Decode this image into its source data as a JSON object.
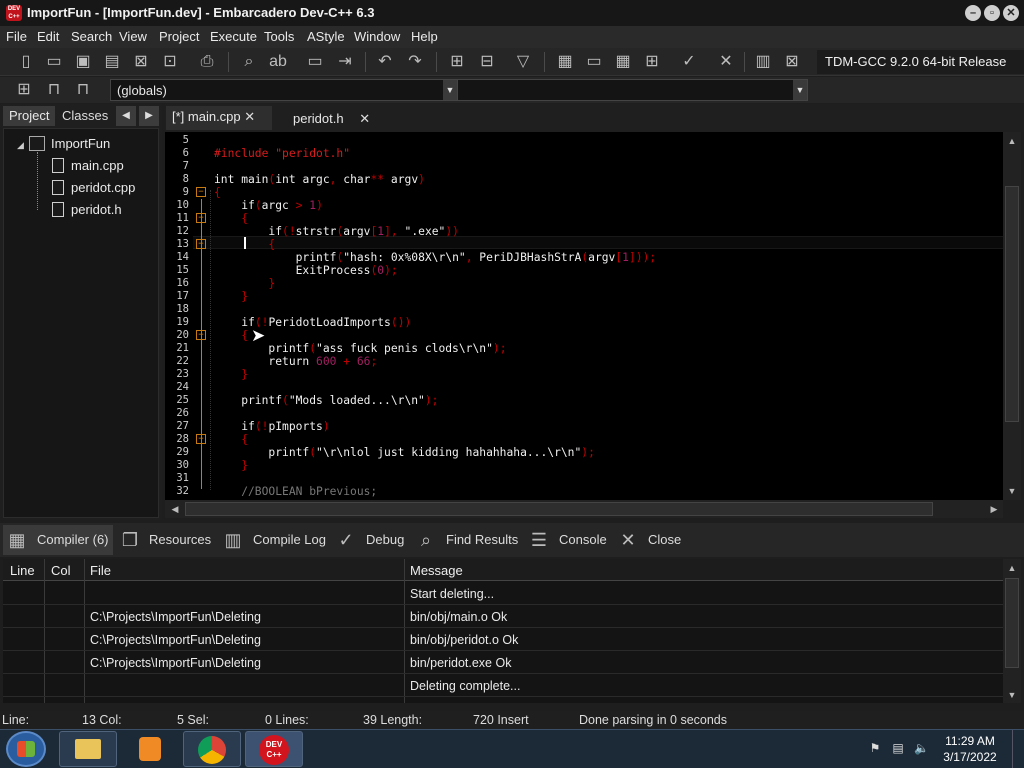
{
  "window": {
    "title": "ImportFun - [ImportFun.dev] - Embarcadero Dev-C++ 6.3",
    "icon_text": "DEV C++"
  },
  "window_buttons": [
    "minimize-icon",
    "restore-icon",
    "close-icon"
  ],
  "menu": [
    "File",
    "Edit",
    "Search",
    "View",
    "Project",
    "Execute",
    "Tools",
    "AStyle",
    "Window",
    "Help"
  ],
  "toolbar": {
    "compiler": "TDM-GCC 9.2.0 64-bit Release",
    "scope": "(globals)"
  },
  "left_panel": {
    "tabs": [
      "Project",
      "Classes"
    ],
    "tree": {
      "project": "ImportFun",
      "files": [
        "main.cpp",
        "peridot.cpp",
        "peridot.h"
      ]
    }
  },
  "editor": {
    "tabs": [
      "[*] main.cpp",
      "peridot.h"
    ],
    "lines": [
      {
        "n": "5",
        "text": ""
      },
      {
        "n": "6",
        "text": "#include \"peridot.h\""
      },
      {
        "n": "7",
        "text": ""
      },
      {
        "n": "8",
        "text": "int main(int argc, char** argv)"
      },
      {
        "n": "9",
        "text": "{"
      },
      {
        "n": "10",
        "text": "    if(argc > 1)"
      },
      {
        "n": "11",
        "text": "    {"
      },
      {
        "n": "12",
        "text": "        if(!strstr(argv[1], \".exe\"))"
      },
      {
        "n": "13",
        "text": "        {"
      },
      {
        "n": "14",
        "text": "            printf(\"hash: 0x%08X\\r\\n\", PeriDJBHashStrA(argv[1]));"
      },
      {
        "n": "15",
        "text": "            ExitProcess(0);"
      },
      {
        "n": "16",
        "text": "        }"
      },
      {
        "n": "17",
        "text": "    }"
      },
      {
        "n": "18",
        "text": ""
      },
      {
        "n": "19",
        "text": "    if(!PeridotLoadImports())"
      },
      {
        "n": "20",
        "text": "    {"
      },
      {
        "n": "21",
        "text": "        printf(\"ass fuck penis clods\\r\\n\");"
      },
      {
        "n": "22",
        "text": "        return 600 + 66;"
      },
      {
        "n": "23",
        "text": "    }"
      },
      {
        "n": "24",
        "text": ""
      },
      {
        "n": "25",
        "text": "    printf(\"Mods loaded...\\r\\n\");"
      },
      {
        "n": "26",
        "text": ""
      },
      {
        "n": "27",
        "text": "    if(!pImports)"
      },
      {
        "n": "28",
        "text": "    {"
      },
      {
        "n": "29",
        "text": "        printf(\"\\r\\nlol just kidding hahahhaha...\\r\\n\");"
      },
      {
        "n": "30",
        "text": "    }"
      },
      {
        "n": "31",
        "text": ""
      },
      {
        "n": "32",
        "text": "    //BOOLEAN bPrevious;"
      }
    ]
  },
  "bottom_tabs": [
    "Compiler (6)",
    "Resources",
    "Compile Log",
    "Debug",
    "Find Results",
    "Console",
    "Close"
  ],
  "messages": {
    "columns": [
      "Line",
      "Col",
      "File",
      "Message"
    ],
    "rows": [
      {
        "line": "",
        "col": "",
        "file": "",
        "message": "Start deleting..."
      },
      {
        "line": "",
        "col": "",
        "file": "C:\\Projects\\ImportFun\\Deleting",
        "message": "bin/obj/main.o Ok"
      },
      {
        "line": "",
        "col": "",
        "file": "C:\\Projects\\ImportFun\\Deleting",
        "message": "bin/obj/peridot.o Ok"
      },
      {
        "line": "",
        "col": "",
        "file": "C:\\Projects\\ImportFun\\Deleting",
        "message": "bin/peridot.exe Ok"
      },
      {
        "line": "",
        "col": "",
        "file": "",
        "message": "Deleting complete..."
      }
    ]
  },
  "status": {
    "line": "Line:",
    "col": "13 Col:",
    "sel": "5 Sel:",
    "lines": "0 Lines:",
    "length": "39 Length:",
    "insert": "720 Insert",
    "parse": "Done parsing in 0 seconds"
  },
  "taskbar": {
    "apps": [
      "explorer-icon",
      "media-player-icon",
      "chrome-icon",
      "devcpp-icon"
    ],
    "time": "11:29 AM",
    "date": "3/17/2022"
  }
}
